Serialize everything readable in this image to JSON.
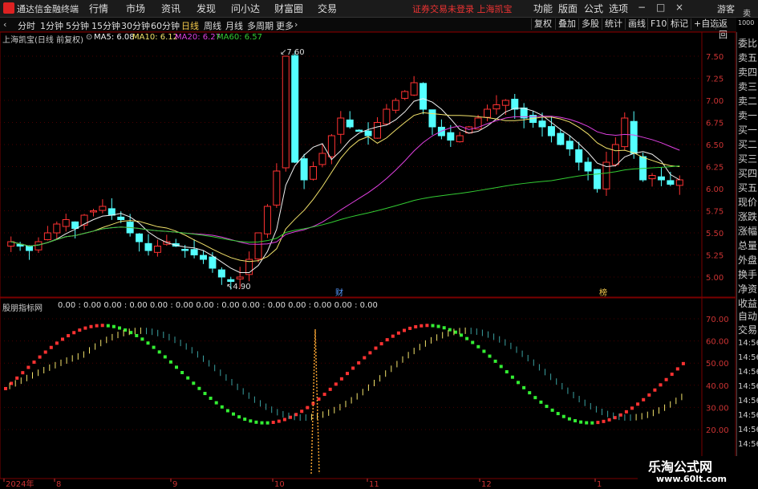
{
  "menubar": {
    "app_name": "通达信金融终端",
    "menus": [
      "行情",
      "市场",
      "资讯",
      "发现",
      "问小达",
      "财富圈",
      "交易"
    ],
    "notice": "证券交易未登录 上海凯宝",
    "right_menus": [
      "功能",
      "版面",
      "公式",
      "选项"
    ],
    "guest": "游客"
  },
  "tabbar": {
    "periods": [
      "分时",
      "1分钟",
      "5分钟",
      "15分钟",
      "30分钟",
      "60分钟",
      "日线",
      "周线",
      "月线",
      "多周期",
      "更多"
    ],
    "active": "日线",
    "buttons": [
      "复权",
      "叠加",
      "多股",
      "统计",
      "画线",
      "F10",
      "标记",
      "+自选",
      "返回"
    ]
  },
  "stock": {
    "title": "上海凯宝(日线 前复权)",
    "ma": [
      {
        "label": "MA5: 6.08",
        "color": "#f0f0f0"
      },
      {
        "label": "MA10: 6.12",
        "color": "#f2e26b"
      },
      {
        "label": "MA20: 6.27",
        "color": "#e040e0"
      },
      {
        "label": "MA60: 6.57",
        "color": "#33cc33"
      }
    ],
    "high_label": "7.60",
    "low_label": "4.90",
    "event1": "财",
    "event2": "榜"
  },
  "indicator": {
    "title": "股朋指标网",
    "values_text": "0.00 : 0.00   0.00 : 0.00   0.00 : 0.00   0.00 : 0.00   0.00 : 0.00   0.00 : 0.00   0.00 : 0.00"
  },
  "axis": {
    "price_ticks": [
      "7.50",
      "7.25",
      "7.00",
      "6.75",
      "6.50",
      "6.25",
      "6.00",
      "5.75",
      "5.50",
      "5.25",
      "5.00"
    ],
    "ind_ticks": [
      "70.00",
      "60.00",
      "50.00",
      "40.00",
      "30.00",
      "20.00"
    ],
    "dates": [
      "2024年",
      "8",
      "9",
      "10",
      "11",
      "12",
      "1"
    ]
  },
  "sidebar": {
    "top": [
      "委比",
      "卖五",
      "卖四",
      "卖三",
      "卖二",
      "卖一",
      "买一",
      "买二",
      "买三",
      "买四",
      "买五",
      "现价",
      "涨跌",
      "涨幅",
      "总量",
      "外盘",
      "换手",
      "净资",
      "收益"
    ],
    "auto": "自动",
    "trade": "交易",
    "times": [
      "14:56",
      "14:56",
      "14:56",
      "14:56",
      "14:56",
      "14:56",
      "14:56",
      "14:56"
    ],
    "corner_top": "卖",
    "corner_bottom": "1000"
  },
  "watermark": {
    "name": "乐淘公式网",
    "url": "www.60lt.com"
  },
  "chart_data": {
    "type": "candlestick",
    "ylim": [
      4.9,
      7.7
    ],
    "price_path": [
      5.4,
      5.35,
      5.3,
      5.4,
      5.5,
      5.6,
      5.65,
      5.55,
      5.7,
      5.75,
      5.8,
      5.7,
      5.65,
      5.5,
      5.4,
      5.3,
      5.35,
      5.4,
      5.35,
      5.3,
      5.25,
      5.2,
      5.1,
      5.0,
      4.95,
      5.0,
      5.2,
      5.5,
      5.8,
      6.2,
      7.5,
      6.3,
      6.1,
      6.25,
      6.4,
      6.6,
      6.8,
      6.7,
      6.65,
      6.6,
      6.75,
      6.9,
      7.0,
      7.1,
      7.2,
      6.9,
      6.7,
      6.6,
      6.55,
      6.6,
      6.7,
      6.8,
      6.9,
      6.95,
      7.0,
      6.9,
      6.8,
      6.75,
      6.7,
      6.6,
      6.5,
      6.45,
      6.3,
      6.2,
      6.0,
      6.3,
      6.5,
      6.8,
      6.4,
      6.1,
      6.15,
      6.1,
      6.05,
      6.1
    ]
  }
}
